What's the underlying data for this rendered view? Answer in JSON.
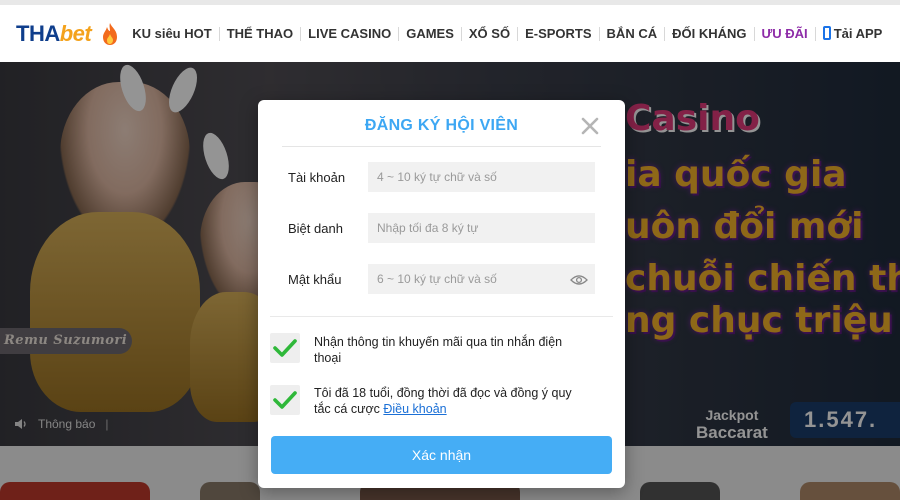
{
  "header": {
    "logo_left": "THA",
    "logo_right": "bet",
    "nav_items": [
      "KU siêu HOT",
      "THỂ THAO",
      "LIVE CASINO",
      "GAMES",
      "XỔ SỐ",
      "E-SPORTS",
      "BẮN CÁ",
      "ĐỐI KHÁNG",
      "ƯU ĐÃI",
      "Tải APP"
    ]
  },
  "banner": {
    "name_tag": "Remu Suzumori",
    "headline_1": "Casino",
    "headline_2": "ia quốc gia",
    "headline_3": "uôn đổi mới",
    "headline_4": "chuỗi chiến thắ",
    "headline_5": "ng chục triệu",
    "jackpot_label_1": "Jackpot",
    "jackpot_label_2": "Baccarat",
    "jackpot_amount": "1.547.",
    "notice_label": "Thông báo"
  },
  "modal": {
    "title": "ĐĂNG KÝ HỘI VIÊN",
    "fields": [
      {
        "label": "Tài khoản",
        "placeholder": "4 ~ 10 ký tự chữ và số",
        "value": ""
      },
      {
        "label": "Biệt danh",
        "placeholder": "Nhập tối đa 8 ký tự",
        "value": ""
      },
      {
        "label": "Mật khẩu",
        "placeholder": "6 ~ 10 ký tự chữ và số",
        "value": ""
      }
    ],
    "checkboxes": [
      {
        "text": "Nhận thông tin khuyến mãi qua tin nhắn điện thoại",
        "checked": true
      },
      {
        "text_before": "Tôi đã 18 tuổi, đồng thời đã đọc và đồng ý quy tắc cá cược ",
        "link": "Điều khoản",
        "checked": true
      }
    ],
    "submit_label": "Xác nhận"
  },
  "colors": {
    "accent": "#45adf5",
    "title": "#3da7f3",
    "check": "#2fb83a",
    "promo_nav": "#8e2ca8"
  }
}
